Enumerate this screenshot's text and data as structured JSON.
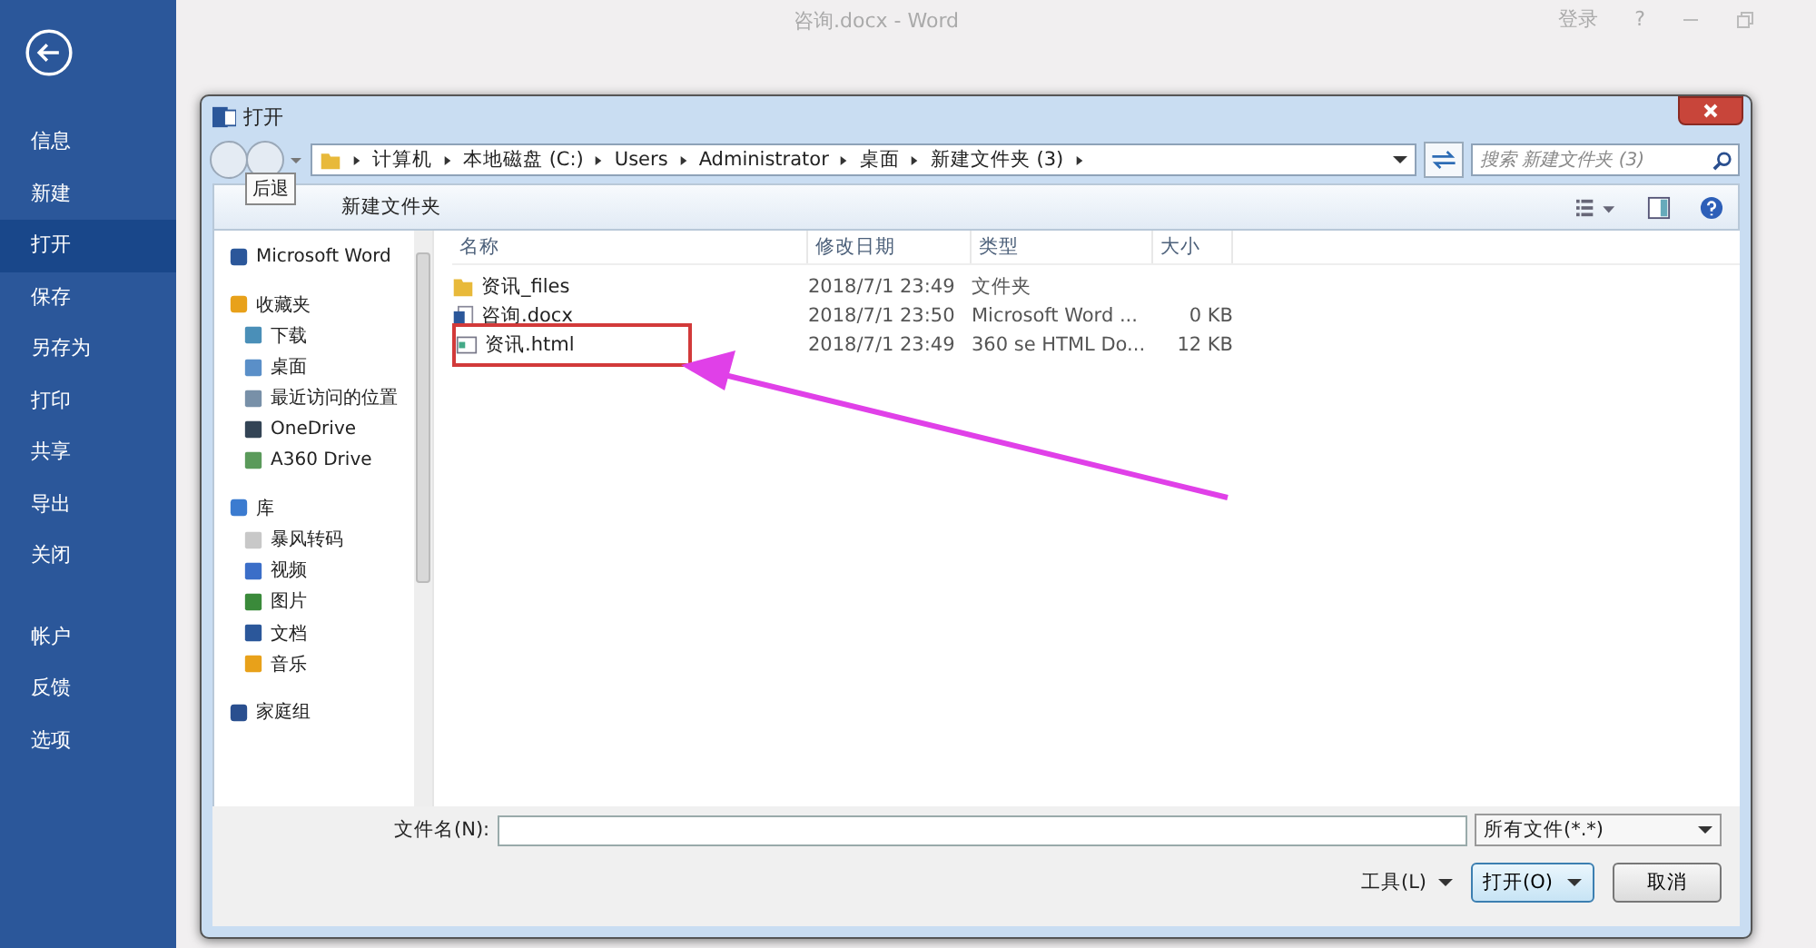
{
  "app": {
    "title": "咨询.docx - Word",
    "sign_in": "登录",
    "help": "?"
  },
  "backstage": {
    "menu": [
      {
        "label": "信息",
        "selected": false
      },
      {
        "label": "新建",
        "selected": false
      },
      {
        "label": "打开",
        "selected": true
      },
      {
        "label": "保存",
        "selected": false
      },
      {
        "label": "另存为",
        "selected": false
      },
      {
        "label": "打印",
        "selected": false
      },
      {
        "label": "共享",
        "selected": false
      },
      {
        "label": "导出",
        "selected": false
      },
      {
        "label": "关闭",
        "selected": false
      }
    ],
    "menu_bottom": [
      {
        "label": "帐户",
        "selected": false
      },
      {
        "label": "反馈",
        "selected": false
      },
      {
        "label": "选项",
        "selected": false
      }
    ]
  },
  "dialog": {
    "title": "打开",
    "breadcrumb": [
      "计算机",
      "本地磁盘 (C:)",
      "Users",
      "Administrator",
      "桌面",
      "新建文件夹 (3)"
    ],
    "search": {
      "placeholder": "搜索 新建文件夹 (3)"
    },
    "tooltip": "后退",
    "toolbar": [
      "新建文件夹"
    ],
    "nav": [
      {
        "label": "Microsoft Word"
      },
      {
        "label": "收藏夹",
        "children": [
          {
            "label": "下载"
          },
          {
            "label": "桌面"
          },
          {
            "label": "最近访问的位置"
          },
          {
            "label": "OneDrive"
          },
          {
            "label": "A360 Drive"
          }
        ]
      },
      {
        "label": "库",
        "children": [
          {
            "label": "暴风转码"
          },
          {
            "label": "视频"
          },
          {
            "label": "图片"
          },
          {
            "label": "文档"
          },
          {
            "label": "音乐"
          }
        ]
      },
      {
        "label": "家庭组"
      }
    ],
    "columns": [
      "名称",
      "修改日期",
      "类型",
      "大小"
    ],
    "files": [
      {
        "kind": "folder",
        "name": "资讯_files",
        "date": "2018/7/1 23:49",
        "type": "文件夹",
        "highlighted": false
      },
      {
        "kind": "word",
        "name": "咨询.docx",
        "date": "2018/7/1 23:50",
        "type": "Microsoft Word ...",
        "size": "0 KB",
        "highlighted": false
      },
      {
        "kind": "html",
        "name": "资讯.html",
        "date": "2018/7/1 23:49",
        "type": "360 se HTML Do...",
        "size": "12 KB",
        "highlighted": true
      }
    ],
    "filename_label": "文件名(N):",
    "filter": "所有文件(*.*)",
    "tools": "工具(L)",
    "open": "打开(O)",
    "cancel": "取消"
  }
}
